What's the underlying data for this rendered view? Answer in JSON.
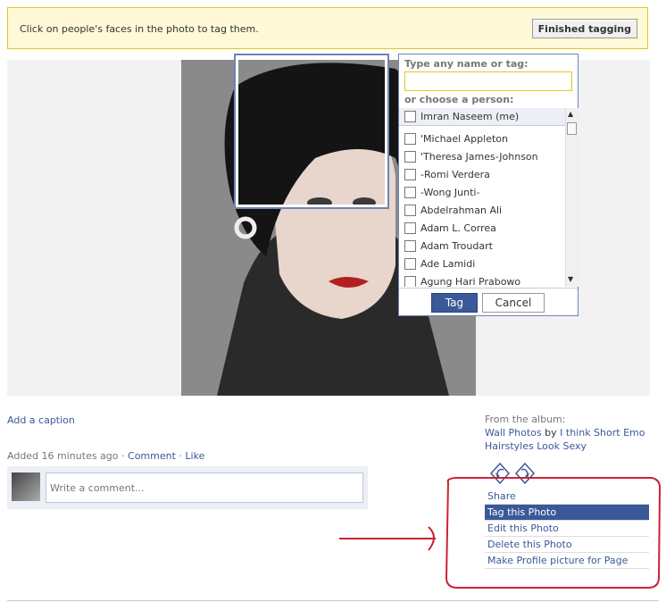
{
  "banner": {
    "instruction": "Click on people's faces in the photo to tag them.",
    "finished_label": "Finished tagging"
  },
  "tag_popup": {
    "name_label": "Type any name or tag:",
    "choose_label": "or choose a person:",
    "me": "Imran Naseem (me)",
    "people": [
      "'Michael Appleton",
      "'Theresa James-Johnson",
      "-Romi Verdera",
      "-Wong Junti-",
      "Abdelrahman Ali",
      "Adam L. Correa",
      "Adam Troudart",
      "Ade Lamidi",
      "Agung Hari Prabowo"
    ],
    "tag_label": "Tag",
    "cancel_label": "Cancel"
  },
  "photo_meta": {
    "caption_link": "Add a caption",
    "added_text": "Added 16 minutes ago",
    "sep": "·",
    "comment_link": "Comment",
    "like_link": "Like",
    "comment_placeholder": "Write a comment..."
  },
  "album": {
    "from_label": "From the album:",
    "album_name": "Wall Photos",
    "by": "by",
    "owner": "I think Short Emo Hairstyles Look Sexy"
  },
  "actions": [
    {
      "label": "Share",
      "active": false
    },
    {
      "label": "Tag this Photo",
      "active": true
    },
    {
      "label": "Edit this Photo",
      "active": false
    },
    {
      "label": "Delete this Photo",
      "active": false
    },
    {
      "label": "Make Profile picture for Page",
      "active": false
    }
  ],
  "colors": {
    "annotation": "#cc2233",
    "brand": "#3b5998"
  }
}
